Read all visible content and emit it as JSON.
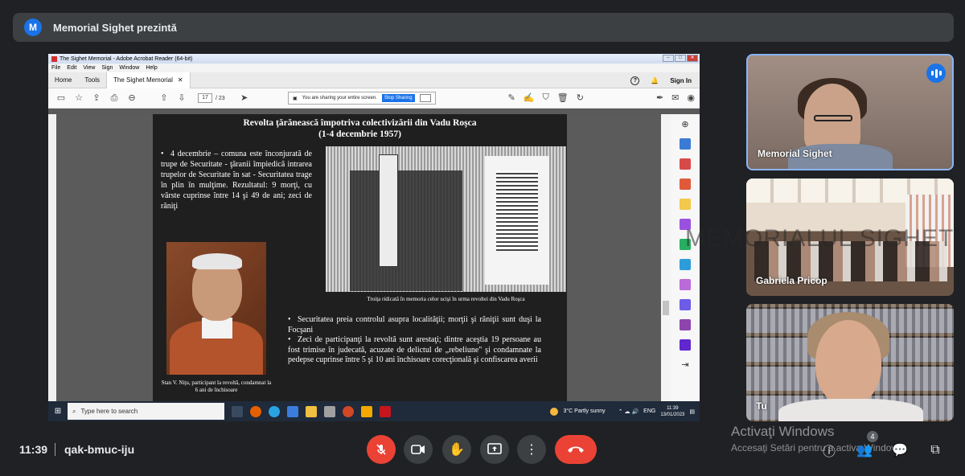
{
  "meeting": {
    "presenter_banner": "Memorial Sighet prezintă",
    "presenter_initial": "M",
    "time": "11:39",
    "code": "qak-bmuc-iju"
  },
  "acrobat": {
    "window_title": "The Sighet Memorial - Adobe Acrobat Reader (64-bit)",
    "menu": [
      "File",
      "Edit",
      "View",
      "Sign",
      "Window",
      "Help"
    ],
    "tabs": {
      "home": "Home",
      "tools": "Tools",
      "doc": "The Sighet Memorial"
    },
    "sign_in": "Sign In",
    "page_current": "17",
    "page_total": "/ 23",
    "sharing_text": "You are sharing your entire screen.",
    "stop_sharing": "Stop Sharing"
  },
  "slide": {
    "title_line1": "Revolta ţărănească împotriva colectivizării din Vadu Roşca",
    "title_line2": "(1-4 decembrie 1957)",
    "left_text": "4 decembrie – comuna este înconjurată de trupe de Securitate - ţăranii împiedică intrarea trupelor de Securitate în sat - Securitatea trage în plin în mulţime. Rezultatul: 9 morţi, cu vârste cuprinse între 14 şi 49 de ani; zeci de răniţi",
    "photo1_caption": "Troiţa ridicată în memoria celor ucişi în urma revoltei din Vadu Roşca",
    "photo2_caption": "Stan V. Niţu, participant la revoltă, condamnat la 6 ani de închisoare",
    "bullet1": "Securitatea preia controlul asupra localităţii; morţii şi răniţii sunt duşi la Focşani",
    "bullet2": "Zeci de participanţi la revoltă sunt arestaţi; dintre aceştia 19 persoane au fost trimise în judecată, acuzate de delictul de „rebeliune\" şi condamnate la pedepse cuprinse între 5 şi 10 ani închisoare corecţională şi confiscarea averii"
  },
  "taskbar": {
    "search_placeholder": "Type here to search",
    "weather": "3°C  Partly sunny",
    "lang": "ENG",
    "clock_time": "11:39",
    "clock_date": "13/01/2023"
  },
  "participants": [
    {
      "name": "Memorial Sighet",
      "speaking": true
    },
    {
      "name": "Gabriela Pricop",
      "speaking": false
    },
    {
      "name": "Tu",
      "speaking": false
    }
  ],
  "watermark": "MEMORIALUL SIGHET",
  "activate_windows": {
    "title": "Activaţi Windows",
    "subtitle": "Accesaţi Setări pentru a activa Windows."
  },
  "people_count": "4",
  "colors": {
    "accent": "#1a73e8",
    "danger": "#ea4335",
    "bg": "#202124"
  }
}
